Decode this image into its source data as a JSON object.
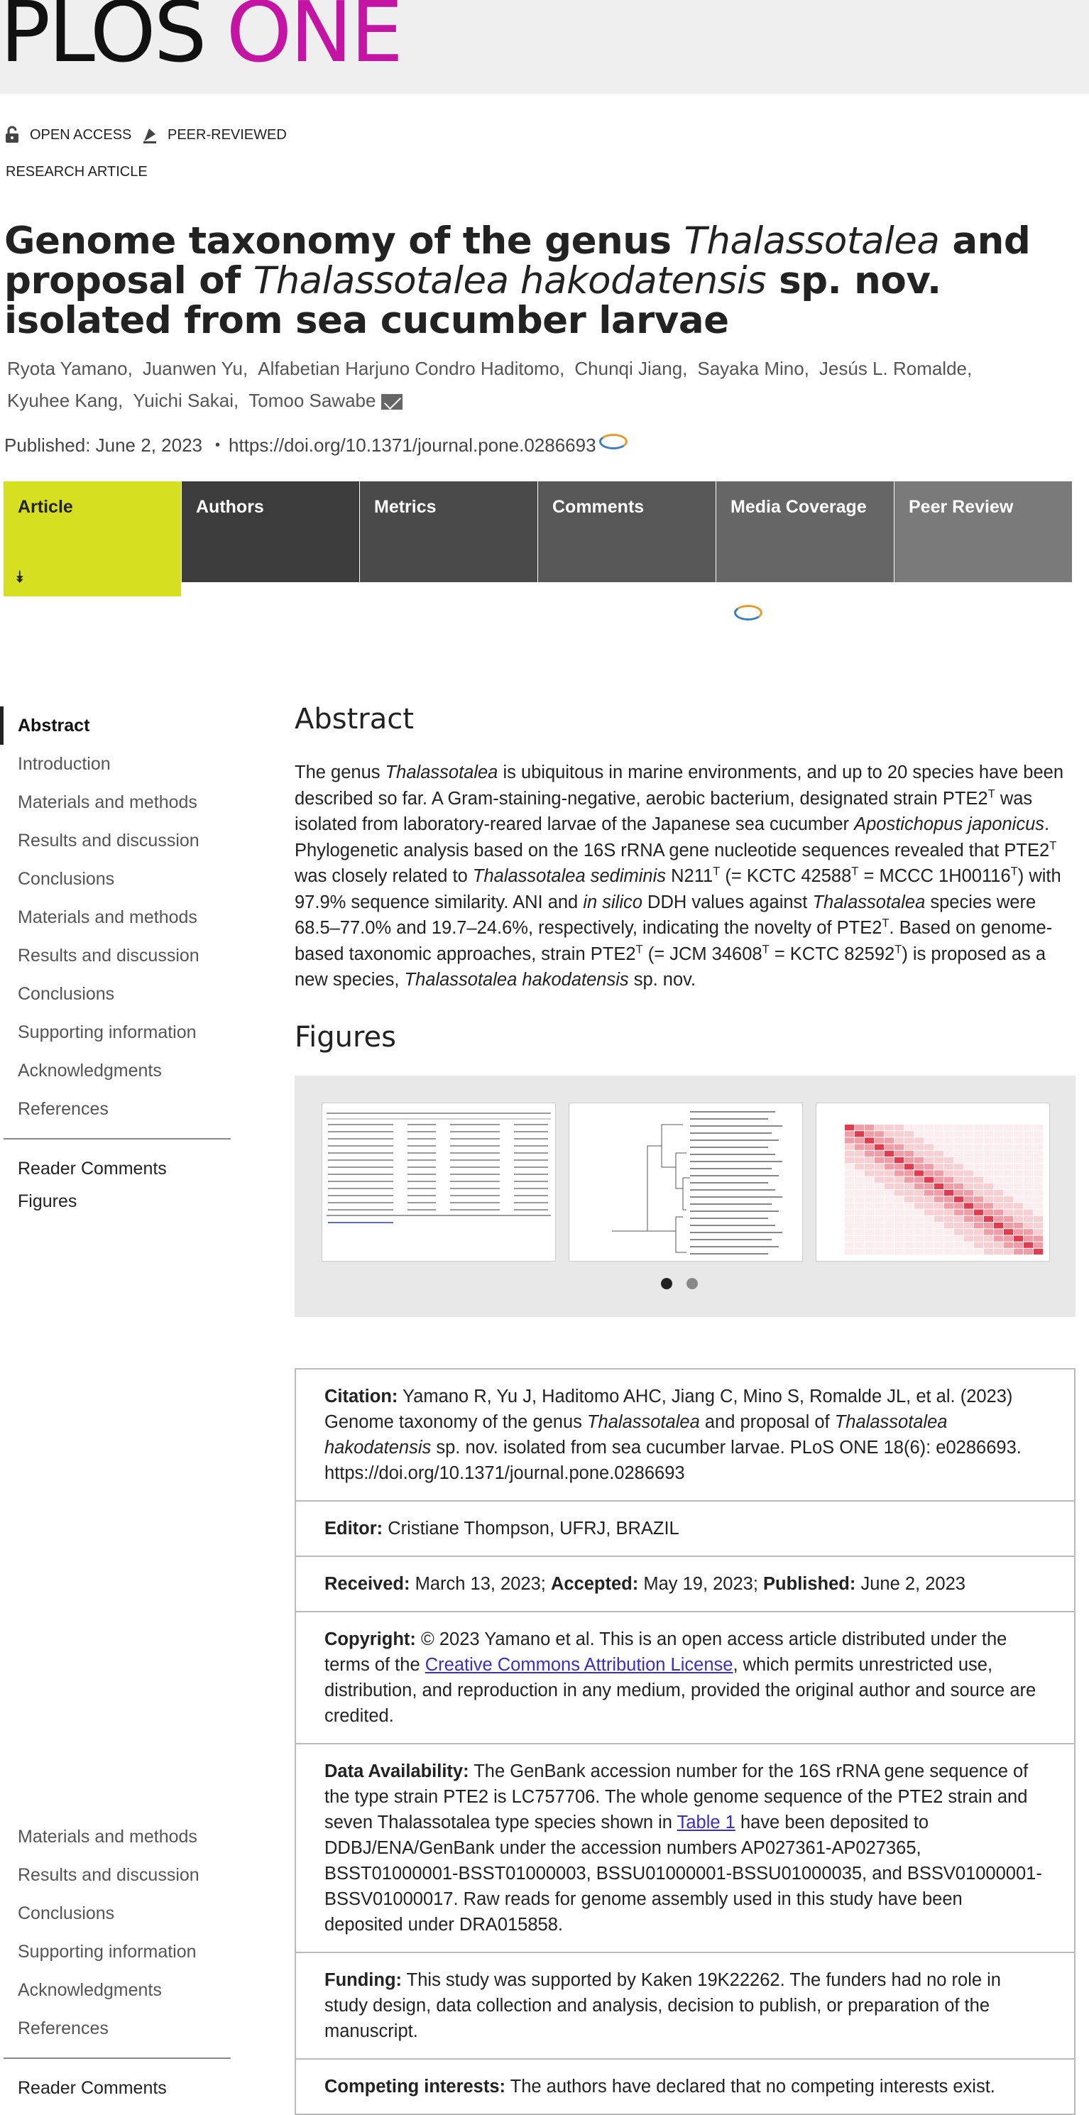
{
  "header": {
    "logo_plos": "PLOS",
    "logo_one": "ONE"
  },
  "flags": {
    "open_access": "OPEN ACCESS",
    "peer_reviewed": "PEER-REVIEWED"
  },
  "article_type": "RESEARCH ARTICLE",
  "authors": [
    "Ryota Yamano,",
    "Juanwen Yu,",
    "Alfabetian Harjuno Condro Haditomo,",
    "Chunqi Jiang,",
    "Sayaka Mino,",
    "Jesús L. Romalde,",
    "Kyuhee Kang,",
    "Yuichi Sakai,",
    "Tomoo Sawabe"
  ],
  "published": "Published: June 2, 2023",
  "doi": "https://doi.org/10.1371/journal.pone.0286693",
  "tabs": [
    {
      "label": "Article",
      "color": "#d6e021"
    },
    {
      "label": "Authors",
      "color": "#3c3c3c"
    },
    {
      "label": "Metrics",
      "color": "#4a4a4a"
    },
    {
      "label": "Comments",
      "color": "#575757"
    },
    {
      "label": "Media Coverage",
      "color": "#666666"
    },
    {
      "label": "Peer Review",
      "color": "#7a7a7a"
    }
  ],
  "toc1": [
    "Abstract",
    "Introduction",
    "Materials and methods",
    "Results and discussion",
    "Conclusions",
    "Materials and methods",
    "Results and discussion",
    "Conclusions",
    "Supporting information",
    "Acknowledgments",
    "References"
  ],
  "toc1_links": [
    "Reader Comments",
    "Figures"
  ],
  "toc2": [
    "Materials and methods",
    "Results and discussion",
    "Conclusions",
    "Supporting information",
    "Acknowledgments",
    "References"
  ],
  "toc2_links": [
    "Reader Comments"
  ],
  "abstract": {
    "heading": "Abstract"
  },
  "figures": {
    "heading": "Figures"
  },
  "meta": {
    "citation_label": "Citation:",
    "editor_label": "Editor:",
    "editor": "Cristiane Thompson, UFRJ, BRAZIL",
    "received_label": "Received:",
    "received": "March 13, 2023;",
    "accepted_label": "Accepted:",
    "accepted": "May 19, 2023;",
    "published_label": "Published:",
    "published": "June 2, 2023",
    "copyright_label": "Copyright:",
    "data_label": "Data Availability:",
    "funding_label": "Funding:",
    "funding": "This study was supported by Kaken 19K22262. The funders had no role in study design, data collection and analysis, decision to publish, or preparation of the manuscript.",
    "competing_label": "Competing interests:",
    "competing": "The authors have declared that no competing interests exist."
  }
}
